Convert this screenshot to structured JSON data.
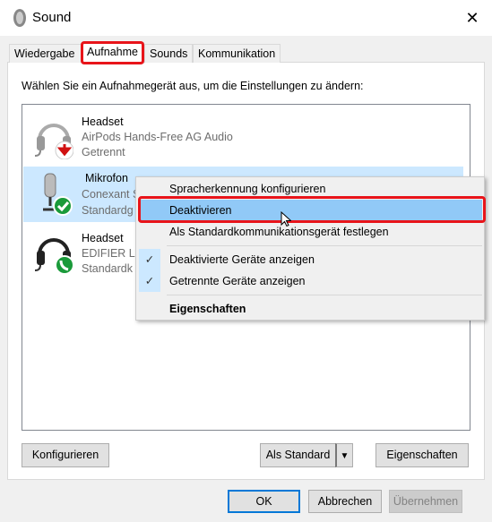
{
  "window": {
    "title": "Sound",
    "icon": "speaker-icon",
    "close": "✕"
  },
  "tabs": [
    {
      "label": "Wiedergabe"
    },
    {
      "label": "Aufnahme",
      "selected": true
    },
    {
      "label": "Sounds"
    },
    {
      "label": "Kommunikation"
    }
  ],
  "instruction": "Wählen Sie ein Aufnahmegerät aus, um die Einstellungen zu ändern:",
  "devices": [
    {
      "name": "Headset",
      "desc": "AirPods Hands-Free AG Audio",
      "status": "Getrennt",
      "icon": "headset-icon",
      "badge": "disconnected-arrow-icon"
    },
    {
      "name": "Mikrofon",
      "desc": "Conexant S",
      "status": "Standardg",
      "icon": "microphone-icon",
      "badge": "default-check-icon",
      "selected": true
    },
    {
      "name": "Headset",
      "desc": "EDIFIER Lo",
      "status": "Standardk",
      "icon": "headset-icon",
      "badge": "communication-phone-icon"
    }
  ],
  "context_menu": {
    "items": [
      {
        "label": "Spracherkennung konfigurieren"
      },
      {
        "label": "Deaktivieren",
        "highlighted": true
      },
      {
        "label": "Als Standardkommunikationsgerät festlegen"
      },
      {
        "label": "Deaktivierte Geräte anzeigen",
        "checked": true
      },
      {
        "label": "Getrennte Geräte anzeigen",
        "checked": true
      },
      {
        "label": "Eigenschaften",
        "bold": true
      }
    ],
    "check": "✓"
  },
  "buttons": {
    "configure": "Konfigurieren",
    "set_default": "Als Standard",
    "properties": "Eigenschaften",
    "ok": "OK",
    "cancel": "Abbrechen",
    "apply": "Übernehmen"
  },
  "colors": {
    "highlight": "#91c9f7",
    "selection": "#cce8ff",
    "annotation": "#e8141a"
  }
}
